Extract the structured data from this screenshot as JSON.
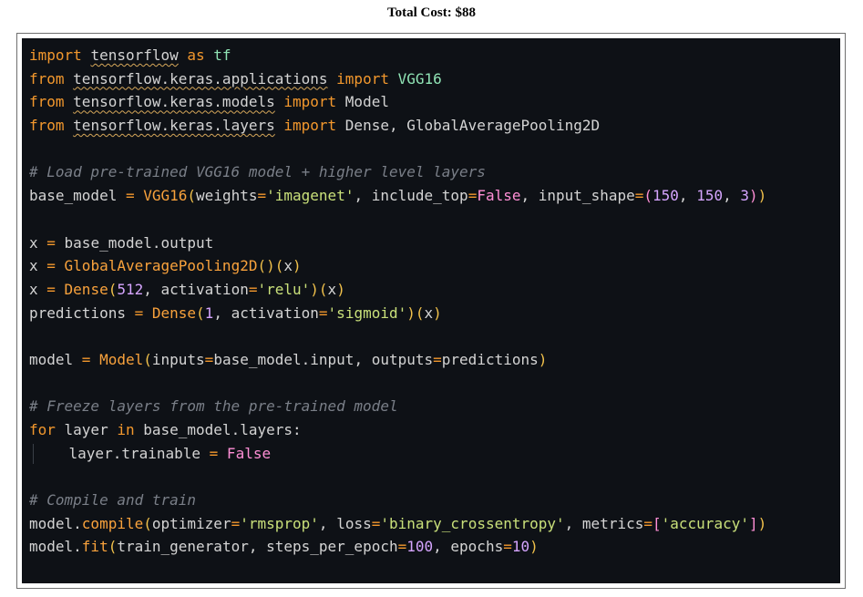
{
  "document": {
    "title": "Total Cost: $88"
  },
  "theme": {
    "background": "#0e1116",
    "default": "#d4d4d4",
    "keyword": "#f3982d",
    "function": "#f9a23c",
    "string": "#c9e07a",
    "number": "#d6a5ff",
    "boolean": "#ff8fd6",
    "comment": "#7a7f88",
    "operator": "#f3982d",
    "class": "#8fe3b4",
    "module": "#d4d4d4",
    "bracket": "#f1c14b",
    "squiggle": "#d7a85a"
  },
  "code_lines": [
    [
      {
        "text": "import ",
        "c": "keyword"
      },
      {
        "text": "tensorflow",
        "c": "module",
        "sq": true
      },
      {
        "text": " as ",
        "c": "keyword"
      },
      {
        "text": "tf",
        "c": "class"
      }
    ],
    [
      {
        "text": "from ",
        "c": "keyword"
      },
      {
        "text": "tensorflow.keras.applications",
        "c": "module",
        "sq": true
      },
      {
        "text": " import ",
        "c": "keyword"
      },
      {
        "text": "VGG16",
        "c": "class"
      }
    ],
    [
      {
        "text": "from ",
        "c": "keyword"
      },
      {
        "text": "tensorflow.keras.models",
        "c": "module",
        "sq": true
      },
      {
        "text": " import ",
        "c": "keyword"
      },
      {
        "text": "Model",
        "c": "module"
      }
    ],
    [
      {
        "text": "from ",
        "c": "keyword"
      },
      {
        "text": "tensorflow.keras.layers",
        "c": "module",
        "sq": true
      },
      {
        "text": " import ",
        "c": "keyword"
      },
      {
        "text": "Dense, GlobalAveragePooling2D",
        "c": "module"
      }
    ],
    [],
    [
      {
        "text": "# Load pre-trained VGG16 model + higher level layers",
        "c": "comment",
        "italic": true
      }
    ],
    [
      {
        "text": "base_model ",
        "c": "default"
      },
      {
        "text": "=",
        "c": "operator"
      },
      {
        "text": " VGG16",
        "c": "function"
      },
      {
        "text": "(",
        "c": "bracket"
      },
      {
        "text": "weights",
        "c": "default"
      },
      {
        "text": "=",
        "c": "operator"
      },
      {
        "text": "'imagenet'",
        "c": "string"
      },
      {
        "text": ", include_top",
        "c": "default"
      },
      {
        "text": "=",
        "c": "operator"
      },
      {
        "text": "False",
        "c": "boolean"
      },
      {
        "text": ", input_shape",
        "c": "default"
      },
      {
        "text": "=",
        "c": "operator"
      },
      {
        "text": "(",
        "c": "boolean"
      },
      {
        "text": "150",
        "c": "number"
      },
      {
        "text": ", ",
        "c": "default"
      },
      {
        "text": "150",
        "c": "number"
      },
      {
        "text": ", ",
        "c": "default"
      },
      {
        "text": "3",
        "c": "number"
      },
      {
        "text": ")",
        "c": "boolean"
      },
      {
        "text": ")",
        "c": "bracket"
      }
    ],
    [],
    [
      {
        "text": "x ",
        "c": "default"
      },
      {
        "text": "=",
        "c": "operator"
      },
      {
        "text": " base_model.output",
        "c": "default"
      }
    ],
    [
      {
        "text": "x ",
        "c": "default"
      },
      {
        "text": "=",
        "c": "operator"
      },
      {
        "text": " GlobalAveragePooling2D",
        "c": "function"
      },
      {
        "text": "()(",
        "c": "bracket"
      },
      {
        "text": "x",
        "c": "default"
      },
      {
        "text": ")",
        "c": "bracket"
      }
    ],
    [
      {
        "text": "x ",
        "c": "default"
      },
      {
        "text": "=",
        "c": "operator"
      },
      {
        "text": " Dense",
        "c": "function"
      },
      {
        "text": "(",
        "c": "bracket"
      },
      {
        "text": "512",
        "c": "number"
      },
      {
        "text": ", activation",
        "c": "default"
      },
      {
        "text": "=",
        "c": "operator"
      },
      {
        "text": "'relu'",
        "c": "string"
      },
      {
        "text": ")(",
        "c": "bracket"
      },
      {
        "text": "x",
        "c": "default"
      },
      {
        "text": ")",
        "c": "bracket"
      }
    ],
    [
      {
        "text": "predictions ",
        "c": "default"
      },
      {
        "text": "=",
        "c": "operator"
      },
      {
        "text": " Dense",
        "c": "function"
      },
      {
        "text": "(",
        "c": "bracket"
      },
      {
        "text": "1",
        "c": "number"
      },
      {
        "text": ", activation",
        "c": "default"
      },
      {
        "text": "=",
        "c": "operator"
      },
      {
        "text": "'sigmoid'",
        "c": "string"
      },
      {
        "text": ")(",
        "c": "bracket"
      },
      {
        "text": "x",
        "c": "default"
      },
      {
        "text": ")",
        "c": "bracket"
      }
    ],
    [],
    [
      {
        "text": "model ",
        "c": "default"
      },
      {
        "text": "=",
        "c": "operator"
      },
      {
        "text": " Model",
        "c": "function"
      },
      {
        "text": "(",
        "c": "bracket"
      },
      {
        "text": "inputs",
        "c": "default"
      },
      {
        "text": "=",
        "c": "operator"
      },
      {
        "text": "base_model.input, outputs",
        "c": "default"
      },
      {
        "text": "=",
        "c": "operator"
      },
      {
        "text": "predictions",
        "c": "default"
      },
      {
        "text": ")",
        "c": "bracket"
      }
    ],
    [],
    [
      {
        "text": "# Freeze layers from the pre-trained model",
        "c": "comment",
        "italic": true
      }
    ],
    [
      {
        "text": "for ",
        "c": "keyword"
      },
      {
        "text": "layer ",
        "c": "default"
      },
      {
        "text": "in ",
        "c": "keyword"
      },
      {
        "text": "base_model.layers:",
        "c": "default"
      }
    ],
    [
      {
        "guide": true
      },
      {
        "text": "    layer.trainable ",
        "c": "default"
      },
      {
        "text": "=",
        "c": "operator"
      },
      {
        "text": " False",
        "c": "boolean"
      }
    ],
    [],
    [
      {
        "text": "# Compile and train",
        "c": "comment",
        "italic": true
      }
    ],
    [
      {
        "text": "model.",
        "c": "default"
      },
      {
        "text": "compile",
        "c": "function"
      },
      {
        "text": "(",
        "c": "bracket"
      },
      {
        "text": "optimizer",
        "c": "default"
      },
      {
        "text": "=",
        "c": "operator"
      },
      {
        "text": "'rmsprop'",
        "c": "string"
      },
      {
        "text": ", loss",
        "c": "default"
      },
      {
        "text": "=",
        "c": "operator"
      },
      {
        "text": "'binary_crossentropy'",
        "c": "string"
      },
      {
        "text": ", metrics",
        "c": "default"
      },
      {
        "text": "=",
        "c": "operator"
      },
      {
        "text": "[",
        "c": "boolean"
      },
      {
        "text": "'accuracy'",
        "c": "string"
      },
      {
        "text": "]",
        "c": "boolean"
      },
      {
        "text": ")",
        "c": "bracket"
      }
    ],
    [
      {
        "text": "model.",
        "c": "default"
      },
      {
        "text": "fit",
        "c": "function"
      },
      {
        "text": "(",
        "c": "bracket"
      },
      {
        "text": "train_generator, steps_per_epoch",
        "c": "default"
      },
      {
        "text": "=",
        "c": "operator"
      },
      {
        "text": "100",
        "c": "number"
      },
      {
        "text": ", epochs",
        "c": "default"
      },
      {
        "text": "=",
        "c": "operator"
      },
      {
        "text": "10",
        "c": "number"
      },
      {
        "text": ")",
        "c": "bracket"
      }
    ]
  ]
}
